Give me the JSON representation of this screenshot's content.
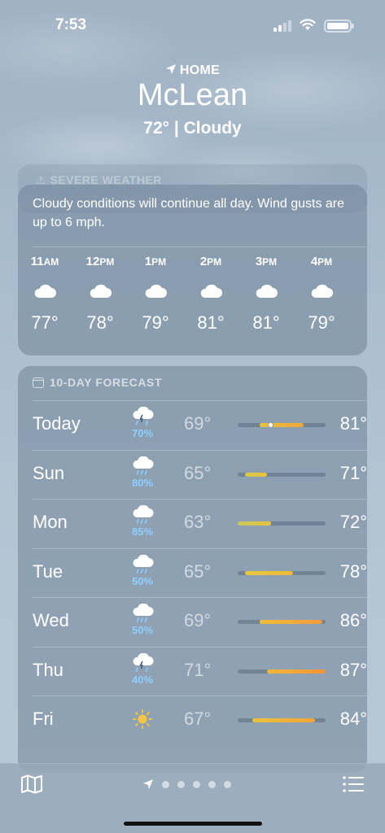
{
  "status_bar": {
    "time": "7:53"
  },
  "header": {
    "home_label": "HOME",
    "city": "McLean",
    "summary": "72°  |  Cloudy"
  },
  "severe": {
    "label": "SEVERE WEATHER"
  },
  "hourly": {
    "description": "Cloudy conditions will continue all day. Wind gusts are up to 6 mph.",
    "hours": [
      {
        "time": "11",
        "period": "AM",
        "icon": "cloud-icon",
        "temp": "77°"
      },
      {
        "time": "12",
        "period": "PM",
        "icon": "cloud-icon",
        "temp": "78°"
      },
      {
        "time": "1",
        "period": "PM",
        "icon": "cloud-icon",
        "temp": "79°"
      },
      {
        "time": "2",
        "period": "PM",
        "icon": "cloud-icon",
        "temp": "81°"
      },
      {
        "time": "3",
        "period": "PM",
        "icon": "cloud-icon",
        "temp": "81°"
      },
      {
        "time": "4",
        "period": "PM",
        "icon": "cloud-icon",
        "temp": "79°"
      }
    ]
  },
  "forecast": {
    "header": "10-DAY FORECAST",
    "range": {
      "min": 63,
      "max": 87
    },
    "days": [
      {
        "day": "Today",
        "icon": "cloud-lightning-rain-icon",
        "precip": "70%",
        "low": "69°",
        "high": "81°",
        "low_val": 69,
        "high_val": 81,
        "current_val": 72,
        "colors": [
          "#e7c43a",
          "#f0a53a"
        ]
      },
      {
        "day": "Sun",
        "icon": "cloud-rain-icon",
        "precip": "80%",
        "low": "65°",
        "high": "71°",
        "low_val": 65,
        "high_val": 71,
        "colors": [
          "#d7c64a",
          "#e9c43a"
        ]
      },
      {
        "day": "Mon",
        "icon": "cloud-rain-icon",
        "precip": "85%",
        "low": "63°",
        "high": "72°",
        "low_val": 63,
        "high_val": 72,
        "colors": [
          "#c9c85a",
          "#e7c43a"
        ]
      },
      {
        "day": "Tue",
        "icon": "cloud-rain-icon",
        "precip": "50%",
        "low": "65°",
        "high": "78°",
        "low_val": 65,
        "high_val": 78,
        "colors": [
          "#e6c83c",
          "#f0b83a"
        ]
      },
      {
        "day": "Wed",
        "icon": "cloud-rain-icon",
        "precip": "50%",
        "low": "69°",
        "high": "86°",
        "low_val": 69,
        "high_val": 86,
        "colors": [
          "#efbf38",
          "#f39a3a"
        ]
      },
      {
        "day": "Thu",
        "icon": "cloud-lightning-rain-icon",
        "precip": "40%",
        "low": "71°",
        "high": "87°",
        "low_val": 71,
        "high_val": 87,
        "colors": [
          "#f0b83a",
          "#f3933a"
        ]
      },
      {
        "day": "Fri",
        "icon": "sun-icon",
        "precip": "",
        "low": "67°",
        "high": "84°",
        "low_val": 67,
        "high_val": 84,
        "colors": [
          "#ecc23a",
          "#f3a43a"
        ]
      }
    ]
  },
  "bottom_bar": {
    "pages": 5
  }
}
